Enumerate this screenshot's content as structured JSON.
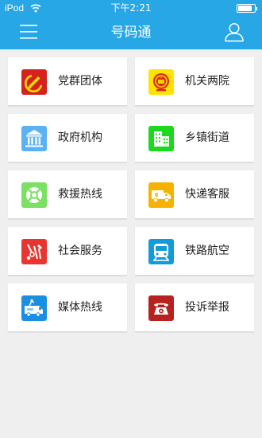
{
  "status_bar": {
    "carrier": "iPod",
    "time": "下午2:21",
    "battery_level": 0.85
  },
  "header": {
    "title": "号码通",
    "menu_icon": "hamburger-menu-icon",
    "user_icon": "user-profile-icon"
  },
  "categories": [
    {
      "label": "党群团体",
      "icon": "party-emblem-icon",
      "color": "#d4221f"
    },
    {
      "label": "机关两院",
      "icon": "national-emblem-icon",
      "color": "#ffe400"
    },
    {
      "label": "政府机构",
      "icon": "government-building-icon",
      "color": "#5bb2f2"
    },
    {
      "label": "乡镇街道",
      "icon": "town-buildings-icon",
      "color": "#1dd81f"
    },
    {
      "label": "救援热线",
      "icon": "rescue-lifebuoy-icon",
      "color": "#7be063"
    },
    {
      "label": "快递客服",
      "icon": "delivery-truck-icon",
      "color": "#f6b101"
    },
    {
      "label": "社会服务",
      "icon": "service-tools-icon",
      "color": "#e8352f"
    },
    {
      "label": "铁路航空",
      "icon": "train-icon",
      "color": "#149ad8"
    },
    {
      "label": "媒体热线",
      "icon": "media-van-icon",
      "color": "#1a8fe1"
    },
    {
      "label": "投诉举报",
      "icon": "complaint-phone-icon",
      "color": "#b6221e"
    }
  ]
}
